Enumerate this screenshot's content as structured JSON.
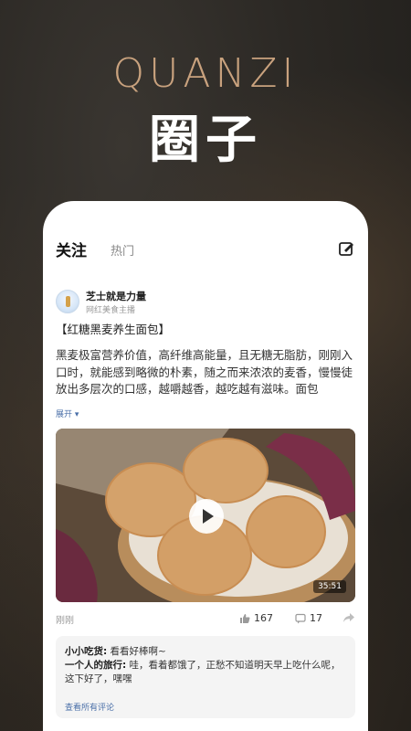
{
  "hero": {
    "en": "QUANZI",
    "zh": "圈子"
  },
  "tabs": {
    "active": "关注",
    "inactive": "热门"
  },
  "post": {
    "username": "芝士就是力量",
    "user_tag": "网红美食主播",
    "title": "【红糖黑麦养生面包】",
    "body": "黑麦极富营养价值，高纤维高能量，且无糖无脂肪，刚刚入口时，就能感到略微的朴素，随之而来浓浓的麦香，慢慢徒放出多层次的口感，越嚼越香，越吃越有滋味。面包",
    "expand": "展开 ▾",
    "video_duration": "35:51",
    "time": "刚刚",
    "likes": "167",
    "comments_count": "17"
  },
  "comments": [
    {
      "name": "小小吃货:",
      "text": "看看好棒啊~"
    },
    {
      "name": "一个人的旅行:",
      "text": "哇，看着都饿了，正愁不知道明天早上吃什么呢，这下好了，嘿嘿"
    }
  ],
  "view_all": "查看所有评论",
  "icons": [
    "edit-icon",
    "avatar",
    "play-icon",
    "like-icon",
    "comment-icon",
    "share-icon"
  ]
}
